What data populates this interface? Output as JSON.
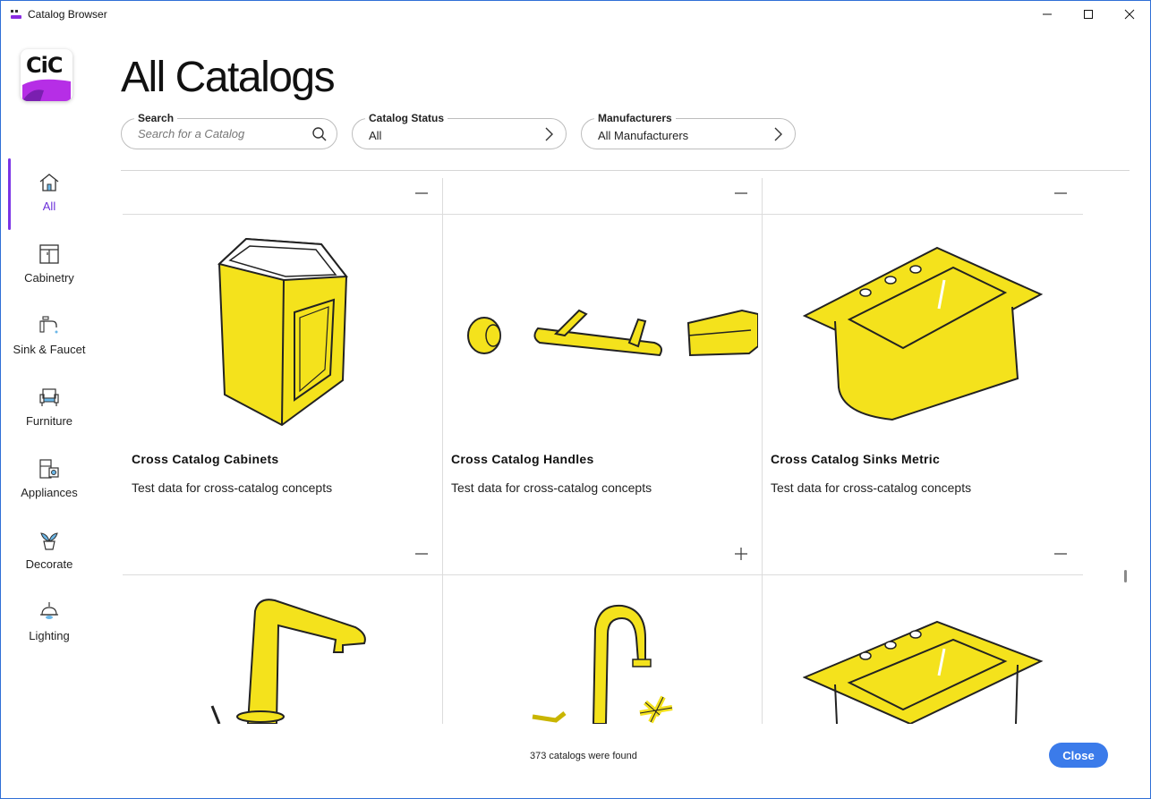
{
  "window": {
    "title": "Catalog Browser"
  },
  "sidebar": {
    "logo_text": "CiC",
    "items": [
      {
        "label": "All",
        "icon": "home-icon",
        "active": true
      },
      {
        "label": "Cabinetry",
        "icon": "cabinet-icon"
      },
      {
        "label": "Sink & Faucet",
        "icon": "faucet-icon"
      },
      {
        "label": "Furniture",
        "icon": "armchair-icon"
      },
      {
        "label": "Appliances",
        "icon": "appliance-icon"
      },
      {
        "label": "Decorate",
        "icon": "plant-icon"
      },
      {
        "label": "Lighting",
        "icon": "lamp-icon"
      }
    ]
  },
  "main": {
    "title": "All Catalogs",
    "search": {
      "label": "Search",
      "placeholder": "Search for a Catalog",
      "value": ""
    },
    "catalog_status": {
      "label": "Catalog Status",
      "value": "All"
    },
    "manufacturers": {
      "label": "Manufacturers",
      "value": "All Manufacturers"
    }
  },
  "cards": [
    {
      "title": "Cross Catalog Cabinets",
      "desc": "Test data for cross-catalog concepts",
      "toggle": "collapse"
    },
    {
      "title": "Cross Catalog Handles",
      "desc": "Test data for cross-catalog concepts",
      "toggle": "collapse"
    },
    {
      "title": "Cross Catalog Sinks Metric",
      "desc": "Test data for cross-catalog concepts",
      "toggle": "collapse"
    },
    {
      "title": "",
      "desc": "",
      "toggle": "collapse"
    },
    {
      "title": "",
      "desc": "",
      "toggle": "expand"
    },
    {
      "title": "",
      "desc": "",
      "toggle": "collapse"
    }
  ],
  "footer": {
    "status": "373 catalogs were found",
    "close_label": "Close"
  },
  "colors": {
    "accent": "#7b35e6",
    "primary_button": "#3b7bea",
    "illustration_yellow": "#f4e21c"
  }
}
